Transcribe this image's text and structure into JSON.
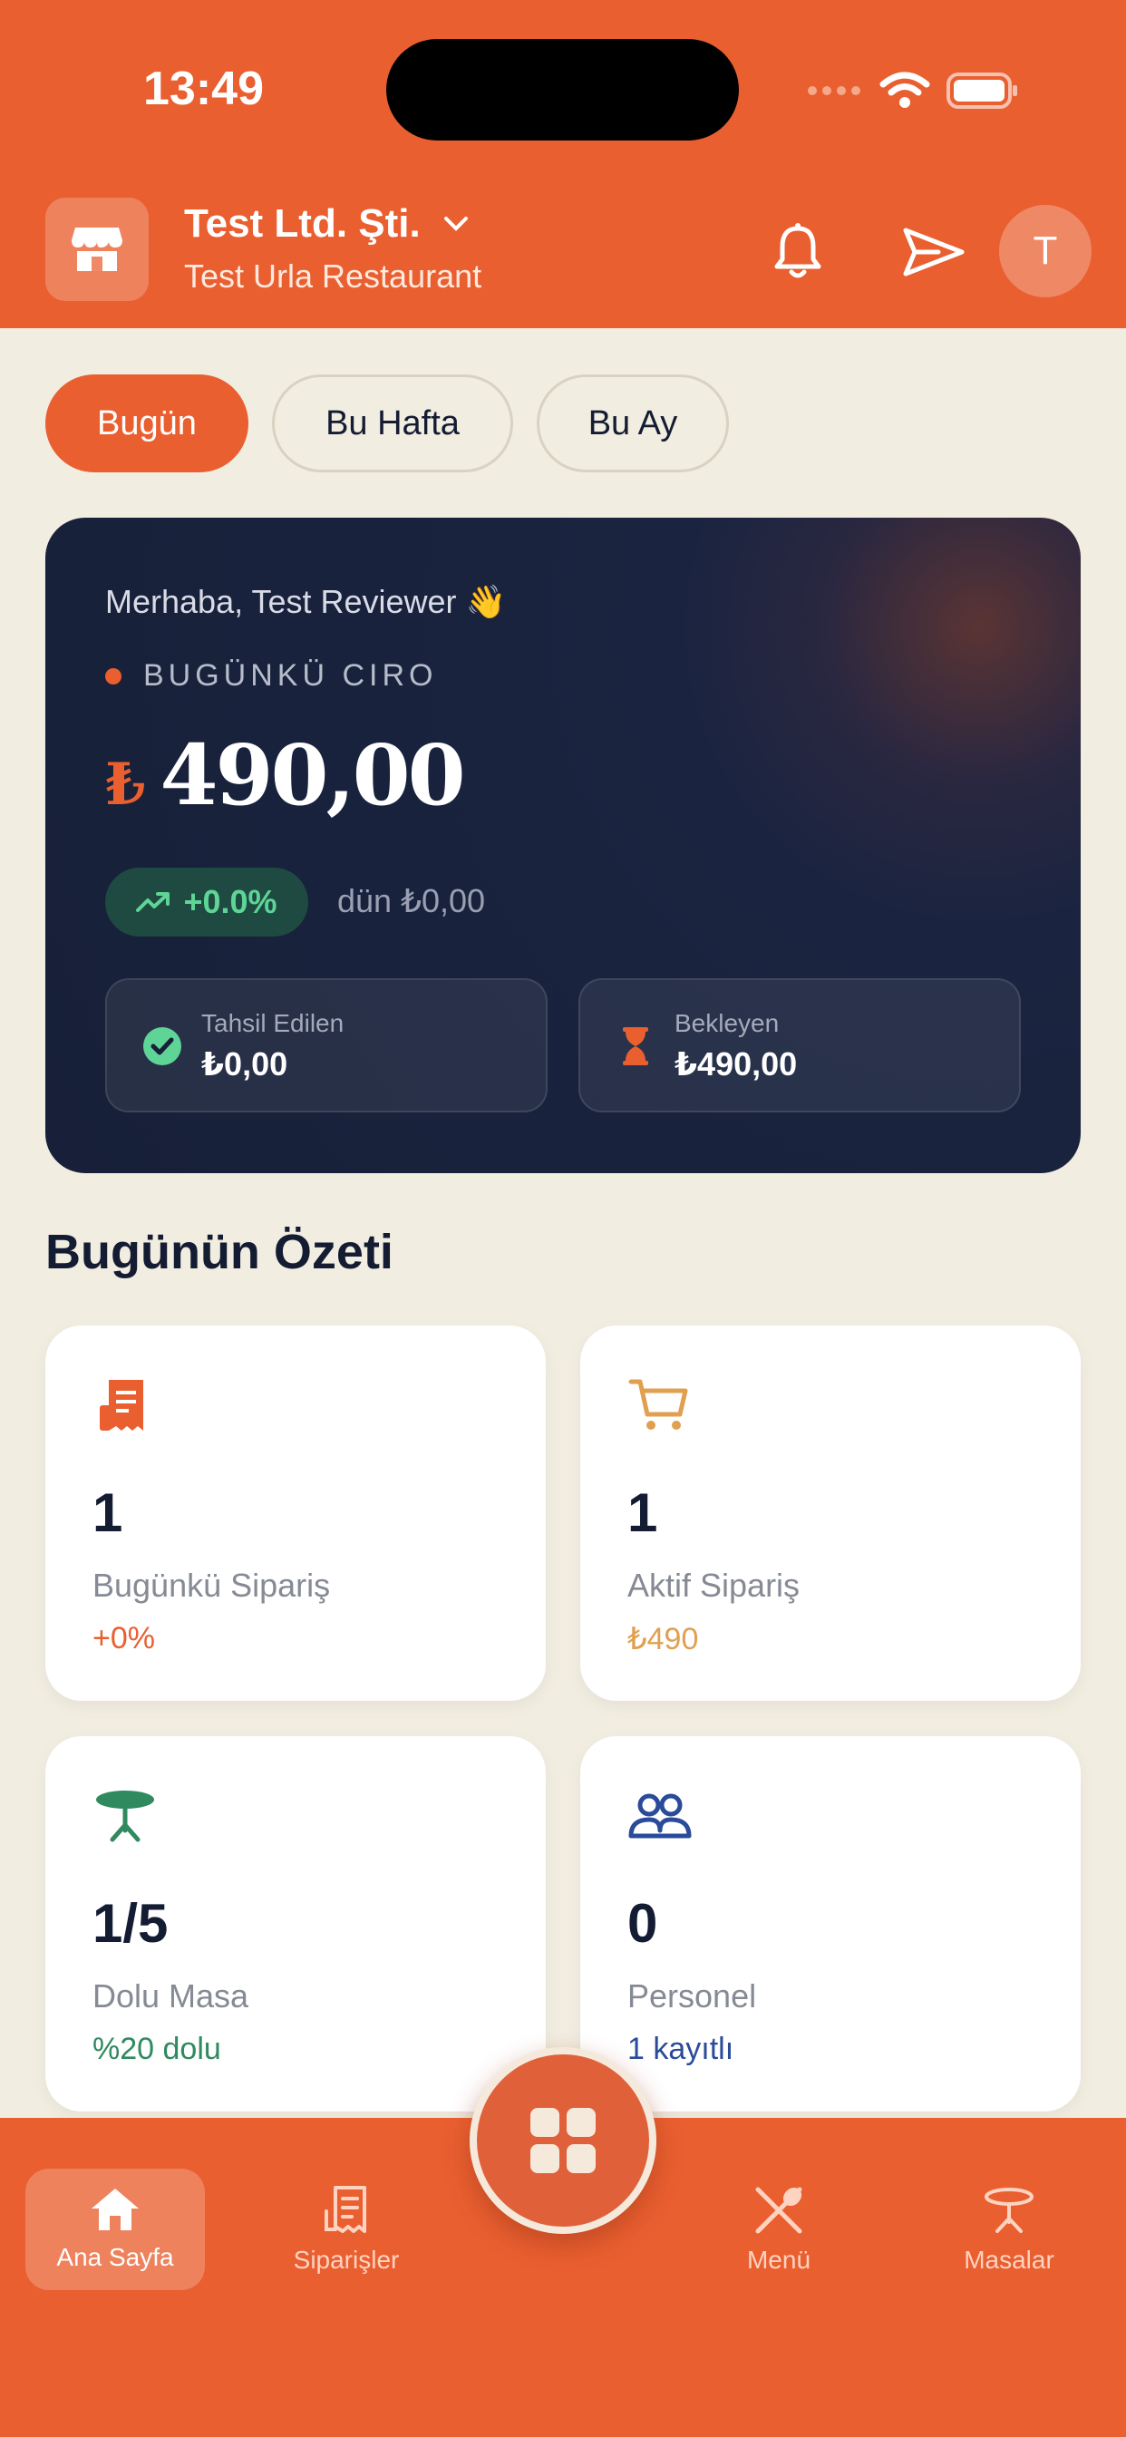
{
  "status_bar": {
    "time": "13:49"
  },
  "header": {
    "company": "Test Ltd. Şti.",
    "branch": "Test Urla Restaurant",
    "avatar_initial": "T",
    "icons": [
      "store-icon",
      "chevron-down-icon",
      "bell-icon",
      "send-icon"
    ]
  },
  "filters": [
    {
      "label": "Bugün",
      "active": true
    },
    {
      "label": "Bu Hafta",
      "active": false
    },
    {
      "label": "Bu Ay",
      "active": false
    }
  ],
  "revenue": {
    "greeting": "Merhaba, Test Reviewer 👋",
    "label": "BUGÜNKÜ CIRO",
    "currency_symbol": "₺",
    "amount": "490,00",
    "trend": "+0.0%",
    "yesterday": "dün ₺0,00",
    "collected": {
      "label": "Tahsil Edilen",
      "value": "₺0,00"
    },
    "pending": {
      "label": "Bekleyen",
      "value": "₺490,00"
    }
  },
  "summary": {
    "title": "Bugünün Özeti",
    "cards": [
      {
        "value": "1",
        "label": "Bugünkü Sipariş",
        "sub": "+0%",
        "color": "#E95F30",
        "icon": "receipt-icon"
      },
      {
        "value": "1",
        "label": "Aktif Sipariş",
        "sub": "₺490",
        "color": "#E0A050",
        "icon": "cart-icon"
      },
      {
        "value": "1/5",
        "label": "Dolu Masa",
        "sub": "%20 dolu",
        "color": "#2F8A5F",
        "icon": "table-icon"
      },
      {
        "value": "0",
        "label": "Personel",
        "sub": "1 kayıtlı",
        "color": "#2A4A9A",
        "icon": "people-icon"
      }
    ]
  },
  "nav": {
    "items": [
      {
        "label": "Ana Sayfa",
        "active": true,
        "icon": "home-icon"
      },
      {
        "label": "Siparişler",
        "active": false,
        "icon": "receipt-icon"
      },
      {
        "label": "Menü",
        "active": false,
        "icon": "cutlery-icon"
      },
      {
        "label": "Masalar",
        "active": false,
        "icon": "table-icon"
      }
    ],
    "center_icon": "grid-icon"
  },
  "colors": {
    "accent": "#E95F30",
    "background": "#F2EDE1",
    "card_dark": "#172038"
  }
}
